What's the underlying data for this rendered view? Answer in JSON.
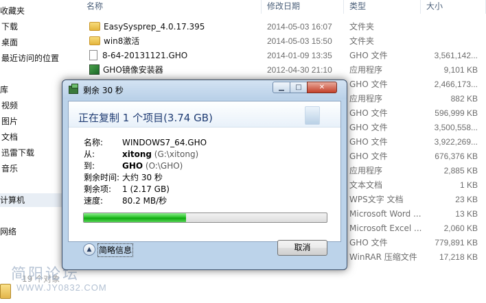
{
  "nav": {
    "items": [
      {
        "label": "收藏夹"
      },
      {
        "label": "下载"
      },
      {
        "label": "桌面"
      },
      {
        "label": "最近访问的位置"
      },
      {
        "label": "库"
      },
      {
        "label": "视频"
      },
      {
        "label": "图片"
      },
      {
        "label": "文档"
      },
      {
        "label": "迅雷下载"
      },
      {
        "label": "音乐"
      },
      {
        "label": "计算机"
      },
      {
        "label": "网络"
      }
    ]
  },
  "columns": {
    "name": "名称",
    "date": "修改日期",
    "type": "类型",
    "size": "大小"
  },
  "files": [
    {
      "name": "EasySysprep_4.0.17.395",
      "date": "2014-05-03 16:07",
      "type": "文件夹",
      "size": "",
      "icon": "folder-icon"
    },
    {
      "name": "win8激活",
      "date": "2014-05-03 15:50",
      "type": "文件夹",
      "size": "",
      "icon": "folder-icon"
    },
    {
      "name": "8-64-20131121.GHO",
      "date": "2014-01-09 13:35",
      "type": "GHO 文件",
      "size": "3,561,142...",
      "icon": "file-icon"
    },
    {
      "name": "GHO镜像安装器",
      "date": "2012-04-30 21:10",
      "type": "应用程序",
      "size": "9,101 KB",
      "icon": "app-icon"
    },
    {
      "name": "",
      "date": "",
      "type": "GHO 文件",
      "size": "2,466,173...",
      "icon": ""
    },
    {
      "name": "",
      "date": "",
      "type": "应用程序",
      "size": "882 KB",
      "icon": ""
    },
    {
      "name": "",
      "date": "",
      "type": "GHO 文件",
      "size": "596,999 KB",
      "icon": ""
    },
    {
      "name": "",
      "date": "",
      "type": "GHO 文件",
      "size": "3,500,558...",
      "icon": ""
    },
    {
      "name": "",
      "date": "",
      "type": "GHO 文件",
      "size": "3,922,269...",
      "icon": ""
    },
    {
      "name": "",
      "date": "",
      "type": "GHO 文件",
      "size": "676,376 KB",
      "icon": ""
    },
    {
      "name": "",
      "date": "",
      "type": "应用程序",
      "size": "2,885 KB",
      "icon": ""
    },
    {
      "name": "",
      "date": "",
      "type": "文本文档",
      "size": "1 KB",
      "icon": ""
    },
    {
      "name": "",
      "date": "",
      "type": "WPS文字 文档",
      "size": "23 KB",
      "icon": ""
    },
    {
      "name": "",
      "date": "",
      "type": "Microsoft Word ...",
      "size": "13 KB",
      "icon": ""
    },
    {
      "name": "",
      "date": "",
      "type": "Microsoft Excel ...",
      "size": "2,060 KB",
      "icon": ""
    },
    {
      "name": "",
      "date": "",
      "type": "GHO 文件",
      "size": "779,891 KB",
      "icon": ""
    },
    {
      "name": "",
      "date": "",
      "type": "WinRAR 压缩文件",
      "size": "17,218 KB",
      "icon": ""
    }
  ],
  "dialog": {
    "title": "剩余 30 秒",
    "heading": "正在复制 1 个项目(3.74 GB)",
    "name_label": "名称:",
    "name_value": "WINDOWS7_64.GHO",
    "from_label": "从:",
    "from_bold": "xitong",
    "from_sub": " (G:\\xitong)",
    "to_label": "到:",
    "to_bold": "GHO",
    "to_sub": " (O:\\GHO)",
    "time_label": "剩余时间:",
    "time_value": "大约 30 秒",
    "items_label": "剩余项:",
    "items_value": "1 (2.17 GB)",
    "speed_label": "速度:",
    "speed_value": "80.2 MB/秒",
    "progress": 0.42,
    "details_label": "简略信息",
    "cancel_label": "取消"
  },
  "status": {
    "count": "19 个对象"
  },
  "watermark": {
    "text": "简阳论坛",
    "url": "WWW.JY0832.COM"
  }
}
